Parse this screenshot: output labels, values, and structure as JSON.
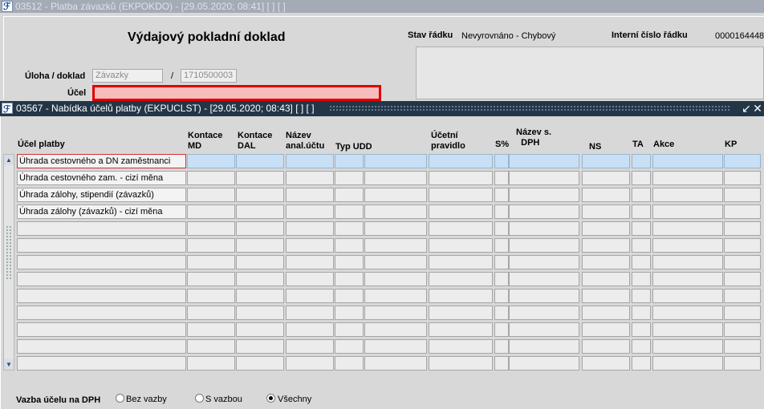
{
  "background_window": {
    "title": "03512 - Platba závazků (EKPOKDO) - [29.05.2020; 08:41]  [ ]  [ ]",
    "heading": "Výdajový pokladní doklad",
    "stav_label": "Stav řádku",
    "stav_value": "Nevyrovnáno - Chybový",
    "interni_label": "Interní číslo řádku",
    "interni_value": "0000164448",
    "uloha_label": "Úloha / doklad",
    "uloha_value": "Závazky",
    "slash": "/",
    "doklad_value": "1710500003",
    "ucel_label": "Účel"
  },
  "dialog": {
    "title": "03567 - Nabídka účelů platby (EKPUCLST) - [29.05.2020; 08:43]  [ ]  [ ]",
    "columns": {
      "ucel": "Účel platby",
      "md": [
        "Kontace",
        "MD"
      ],
      "dal": [
        "Kontace",
        "DAL"
      ],
      "nazev": [
        "Název",
        "anal.účtu"
      ],
      "typ": "Typ UDD",
      "pravidlo": [
        "Účetní",
        "pravidlo"
      ],
      "s": "S%",
      "nazev_dph": [
        "Název s.",
        "DPH"
      ],
      "ns": "NS",
      "ta": "TA",
      "akce": "Akce",
      "kp": "KP"
    },
    "rows": [
      "Úhrada cestovného a DN zaměstnanci",
      "Úhrada cestovného zam. - cizí měna",
      "Úhrada zálohy, stipendií  (závazků)",
      "Úhrada zálohy (závazků) - cizí měna",
      "",
      "",
      "",
      "",
      "",
      "",
      "",
      "",
      ""
    ],
    "vazba_label": "Vazba účelu na DPH",
    "radios": [
      {
        "label": "Bez vazby",
        "checked": false
      },
      {
        "label": "S vazbou",
        "checked": false
      },
      {
        "label": "Všechny",
        "checked": true
      }
    ]
  }
}
